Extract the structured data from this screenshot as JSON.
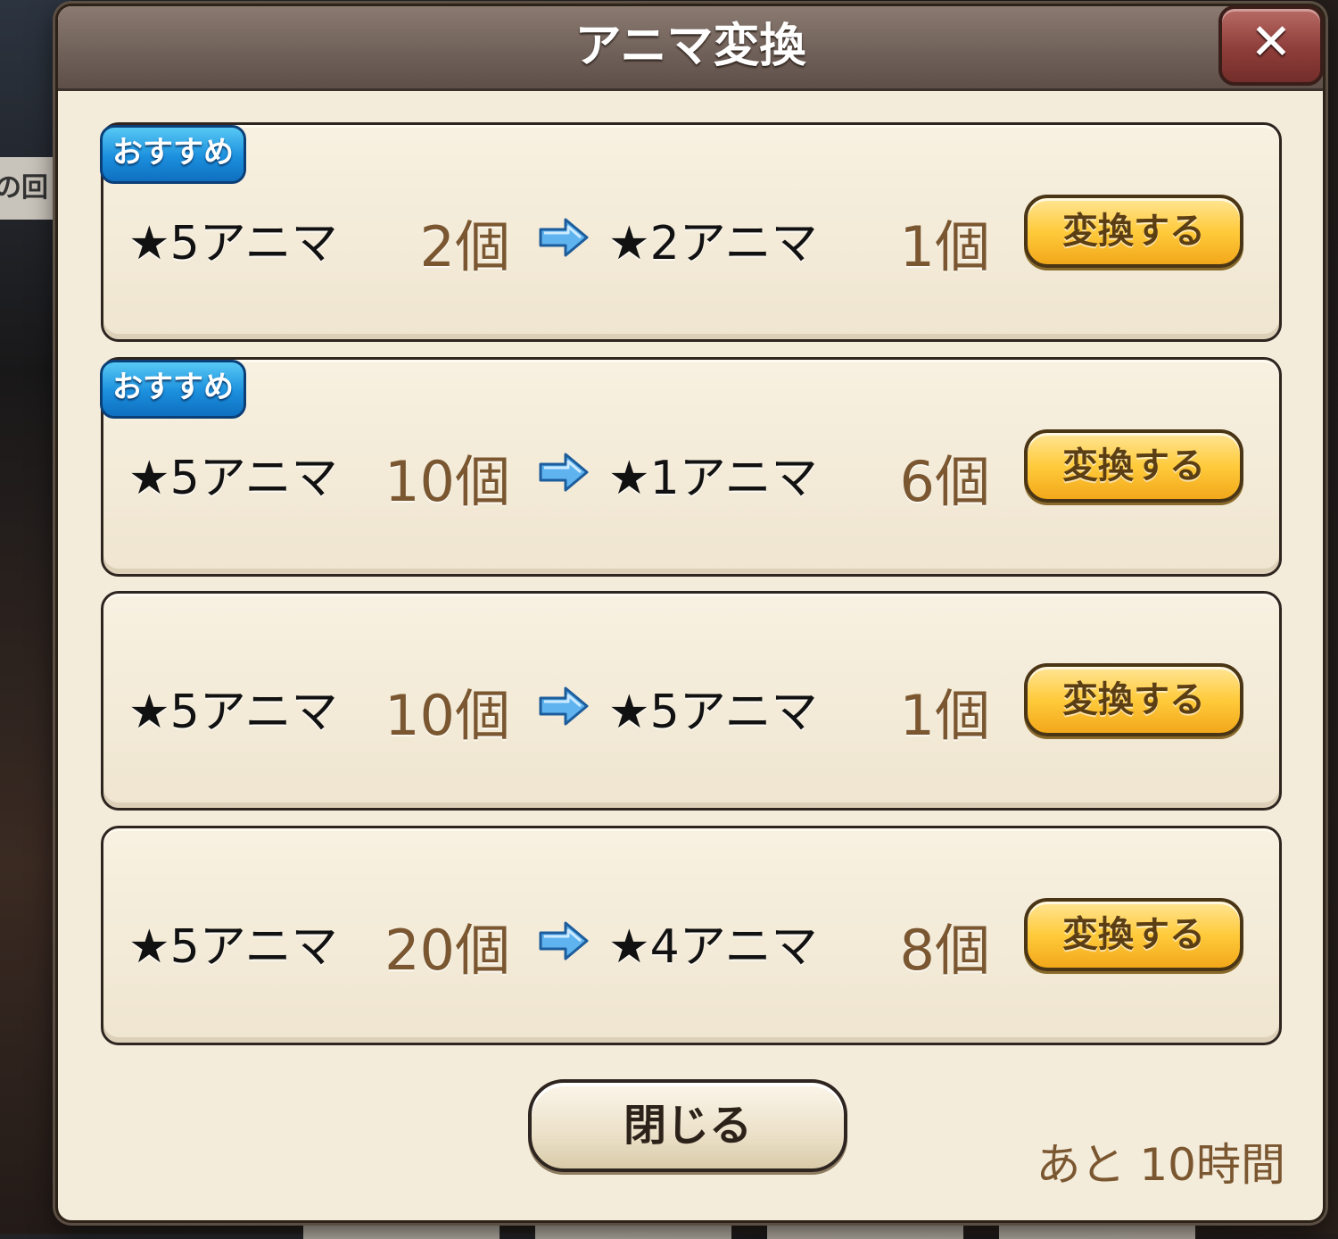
{
  "background": {
    "side_label": "の回"
  },
  "dialog": {
    "title": "アニマ変換",
    "close_icon_glyph": "✕",
    "close_button_label": "閉じる",
    "remaining_time": "あと 10時間"
  },
  "offers": [
    {
      "badge": "おすすめ",
      "from_label": "★5アニマ",
      "from_qty": "2個",
      "to_label": "★2アニマ",
      "to_qty": "1個",
      "button": "変換する"
    },
    {
      "badge": "おすすめ",
      "from_label": "★5アニマ",
      "from_qty": "10個",
      "to_label": "★1アニマ",
      "to_qty": "6個",
      "button": "変換する"
    },
    {
      "badge": "",
      "from_label": "★5アニマ",
      "from_qty": "10個",
      "to_label": "★5アニマ",
      "to_qty": "1個",
      "button": "変換する"
    },
    {
      "badge": "",
      "from_label": "★5アニマ",
      "from_qty": "20個",
      "to_label": "★4アニマ",
      "to_qty": "8個",
      "button": "変換する"
    }
  ],
  "colors": {
    "title_bar": "#6e5f58",
    "panel": "#f4ecdb",
    "badge": "#1b8fdd",
    "convert_button": "#ffcb3c",
    "quantity_text": "#7a5730",
    "close_icon_button": "#8e3e3a"
  }
}
